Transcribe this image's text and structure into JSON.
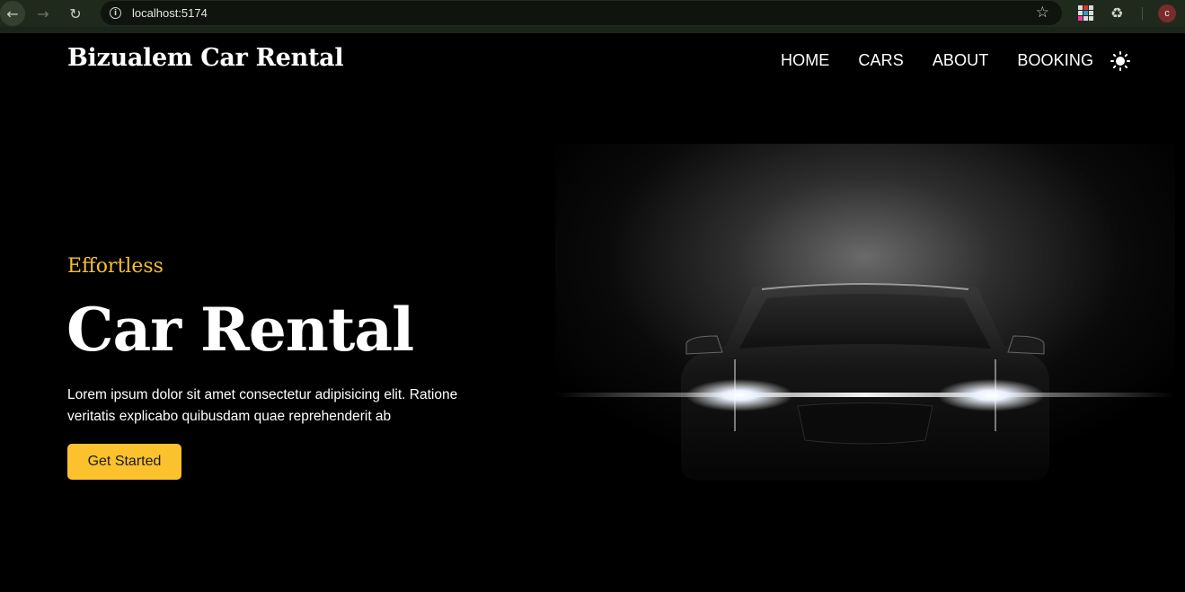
{
  "browser": {
    "url": "localhost:5174",
    "profile_initial": "c",
    "icons": {
      "back": "arrow-left-icon",
      "forward": "arrow-right-icon",
      "reload": "reload-icon",
      "info": "info-icon",
      "bookmark": "star-icon",
      "extension": "extension-icon",
      "extensions_menu": "puzzle-icon"
    }
  },
  "site": {
    "brand": "Bizualem Car Rental",
    "nav": [
      "HOME",
      "CARS",
      "ABOUT",
      "BOOKING"
    ],
    "theme_toggle_icon": "sun-icon"
  },
  "hero": {
    "eyebrow": "Effortless",
    "title": "Car Rental",
    "description": "Lorem ipsum dolor sit amet consectetur adipisicing elit. Ratione veritatis explicabo quibusdam quae reprehenderit ab",
    "cta_label": "Get Started",
    "image": "car-headlights-image"
  },
  "colors": {
    "accent": "#fcc22d",
    "eyebrow": "#f5c02e",
    "background": "#000000"
  }
}
